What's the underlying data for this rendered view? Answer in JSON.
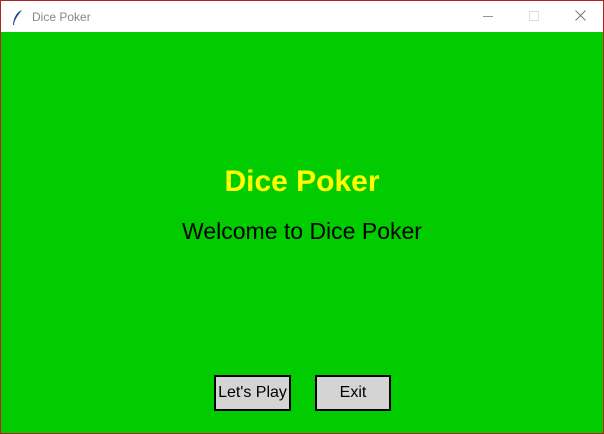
{
  "window": {
    "title": "Dice Poker",
    "icons": {
      "app": "feather-icon",
      "minimize": "minimize-icon",
      "maximize": "maximize-icon",
      "close": "close-icon"
    }
  },
  "main": {
    "heading": "Dice Poker",
    "subheading": "Welcome to Dice Poker",
    "buttons": {
      "play_label": "Let's Play",
      "exit_label": "Exit"
    }
  },
  "colors": {
    "background": "#00cc00",
    "heading": "#ffff00",
    "button_face": "#d4d4d4",
    "window_border": "#b32121"
  }
}
